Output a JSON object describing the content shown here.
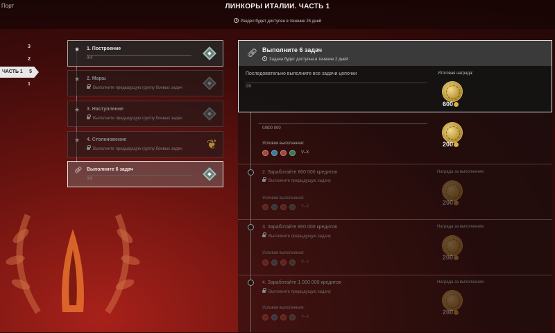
{
  "header": {
    "port_label": "Порт",
    "title": "ЛИНКОРЫ ИТАЛИИ. ЧАСТЬ 1",
    "availability": "Раздел будет доступен в течение 25 дней"
  },
  "parts": {
    "items": [
      "3",
      "2",
      "1"
    ],
    "active_label": "ЧАСТЬ 1",
    "active_num": "5"
  },
  "groups": [
    {
      "title": "1. Построение",
      "sub": "0/4"
    },
    {
      "title": "2. Марш",
      "sub": "Выполните предыдущую группу боевых задач"
    },
    {
      "title": "3. Наступление",
      "sub": "Выполните предыдущую группу боевых задач"
    },
    {
      "title": "4. Столкновение",
      "sub": "Выполните предыдущую группу боевых задач"
    },
    {
      "title": "Выполните 6 задач",
      "sub": "0/6"
    }
  ],
  "task_header": {
    "title": "Выполните 6 задач",
    "subtitle": "Задача будет доступна в течение 2 дней",
    "description": "Последовательно выполните все задачи цепочки",
    "progress": "0/6",
    "reward_label": "Итоговая награда:",
    "reward_value": "600"
  },
  "tasks": [
    {
      "title": "",
      "progress": "0/800 000",
      "cond_label": "Условия выполнения:",
      "tiers": "V–X",
      "reward_label": "",
      "reward_value": "200"
    },
    {
      "title": "2. Заработайте 800 000 кредитов",
      "sub": "Выполните предыдущую задачу",
      "cond_label": "Условия выполнения:",
      "tiers": "V–X",
      "reward_label": "Награда за выполнение:",
      "reward_value": "200"
    },
    {
      "title": "3. Заработайте 800 000 кредитов",
      "sub": "Выполните предыдущую задачу",
      "cond_label": "Условия выполнения:",
      "tiers": "V–X",
      "reward_label": "Награда за выполнение:",
      "reward_value": "200"
    },
    {
      "title": "4. Заработайте 1 000 000 кредитов",
      "sub": "Выполните предыдущую задачу",
      "cond_label": "Условия выполнения:",
      "tiers": "V–X",
      "reward_label": "Награда за выполнение:",
      "reward_value": "200"
    }
  ]
}
